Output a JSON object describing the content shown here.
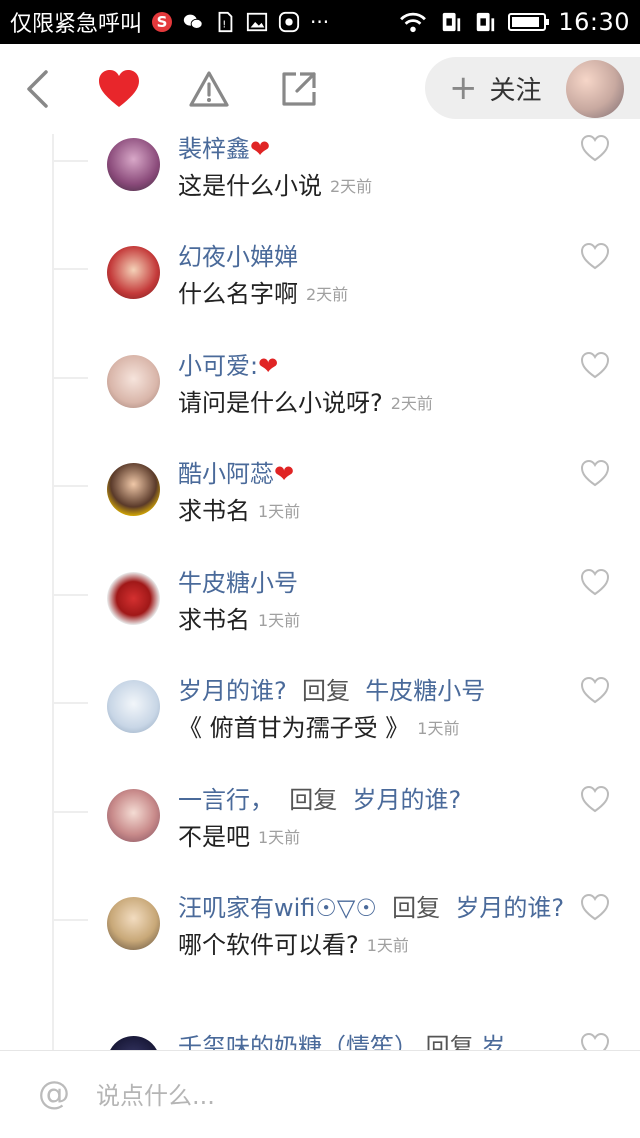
{
  "status_bar": {
    "carrier": "仅限紧急呼叫",
    "weibo_badge": "S",
    "time": "16:30",
    "battery_level": 0.9
  },
  "header": {
    "follow_plus": "+",
    "follow_label": "关注",
    "liked": true
  },
  "comments": [
    {
      "name": "裴梓鑫",
      "heart": "❤",
      "reply_word": "",
      "reply_to": "",
      "text": "这是什么小说",
      "time": "2天前"
    },
    {
      "name": "幻夜小婵婵",
      "heart": "",
      "reply_word": "",
      "reply_to": "",
      "text": "什么名字啊",
      "time": "2天前"
    },
    {
      "name": "小可爱:",
      "heart": "❤",
      "reply_word": "",
      "reply_to": "",
      "text": "请问是什么小说呀?",
      "time": "2天前"
    },
    {
      "name": "酷小阿蕊",
      "heart": "❤",
      "reply_word": "",
      "reply_to": "",
      "text": "求书名",
      "time": "1天前"
    },
    {
      "name": "牛皮糖小号",
      "heart": "",
      "reply_word": "",
      "reply_to": "",
      "text": "求书名",
      "time": "1天前"
    },
    {
      "name": "岁月的谁?",
      "heart": "",
      "reply_word": "回复",
      "reply_to": "牛皮糖小号",
      "text": "《 俯首甘为孺子受 》",
      "time": "1天前"
    },
    {
      "name": "一言行，",
      "heart": "",
      "reply_word": "回复",
      "reply_to": "岁月的谁?",
      "text": "不是吧",
      "time": "1天前"
    },
    {
      "name": "汪叽家有wifi☉▽☉",
      "heart": "",
      "reply_word": "回复",
      "reply_to": "岁月的谁?",
      "text": "哪个软件可以看?",
      "time": "1天前"
    },
    {
      "name": "千玺味的奶糖（情笙）",
      "heart": "",
      "reply_word": "回复",
      "reply_to": "岁",
      "text": "",
      "time": ""
    }
  ],
  "composer": {
    "at_symbol": "@",
    "placeholder": "说点什么..."
  },
  "colors": {
    "name_blue": "#4a6a9a",
    "heart_red": "#e02424",
    "time_gray": "#a0a0a0"
  }
}
